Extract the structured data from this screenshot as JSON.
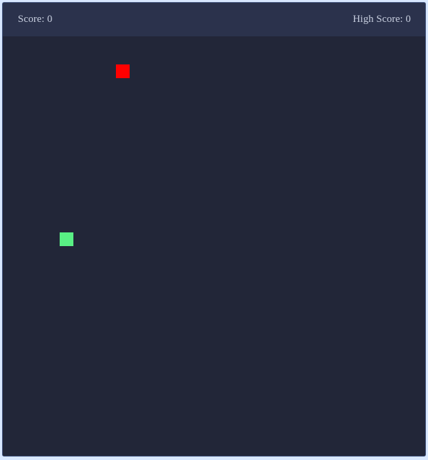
{
  "score": {
    "label": "Score: 0",
    "value": 0
  },
  "high_score": {
    "label": "High Score: 0",
    "value": 0
  },
  "colors": {
    "page_background": "#d9e8ff",
    "header_background": "#2b324c",
    "board_background": "#222638",
    "text": "#c8cfdf",
    "food": "#ff0000",
    "snake": "#59ef84"
  }
}
